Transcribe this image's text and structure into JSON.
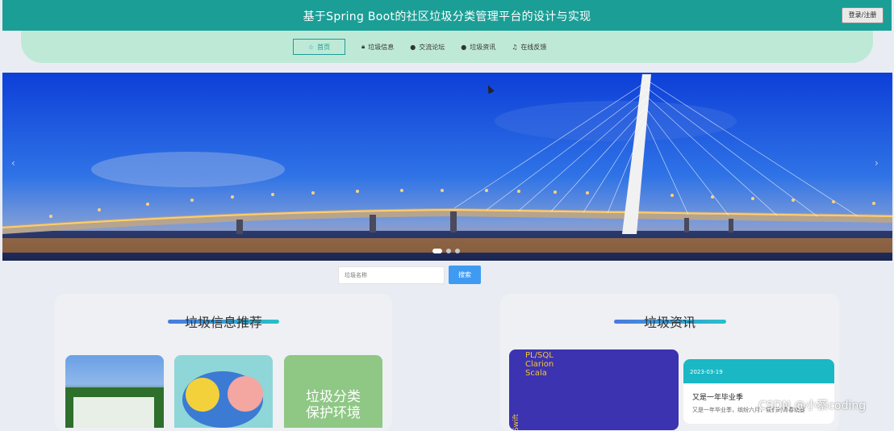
{
  "header": {
    "title": "基于Spring Boot的社区垃圾分类管理平台的设计与实现",
    "login_label": "登录/注册"
  },
  "nav": {
    "items": [
      {
        "label": "首页",
        "icon": "star-icon"
      },
      {
        "label": "垃圾信息",
        "icon": "lock-icon"
      },
      {
        "label": "交流论坛",
        "icon": "info-icon"
      },
      {
        "label": "垃圾资讯",
        "icon": "help-icon"
      },
      {
        "label": "在线反馈",
        "icon": "headset-icon"
      }
    ],
    "active_index": 0
  },
  "banner": {
    "slide_count": 3,
    "active_slide": 0,
    "arrow_left": "‹",
    "arrow_right": "›"
  },
  "search": {
    "placeholder": "垃圾名称",
    "button_label": "搜索"
  },
  "recommend": {
    "title": "垃圾信息推荐",
    "thumb_caption": "垃圾分类\n保护环境"
  },
  "news": {
    "title": "垃圾资讯",
    "card_text": "PL/SQL\nClarion\nScala",
    "card_vertical": "Swift",
    "date": "2023-03-19",
    "item_title": "又是一年毕业季",
    "item_sub": "又是一年毕业季，缤纷六月，我们的青春就要"
  },
  "watermark": "CSDN @小蔡coding",
  "colors": {
    "topbar": "#1b9e95",
    "nav_bg": "#bfe9d7",
    "search_btn": "#3f9bf2",
    "news_head": "#1ab8c4"
  }
}
